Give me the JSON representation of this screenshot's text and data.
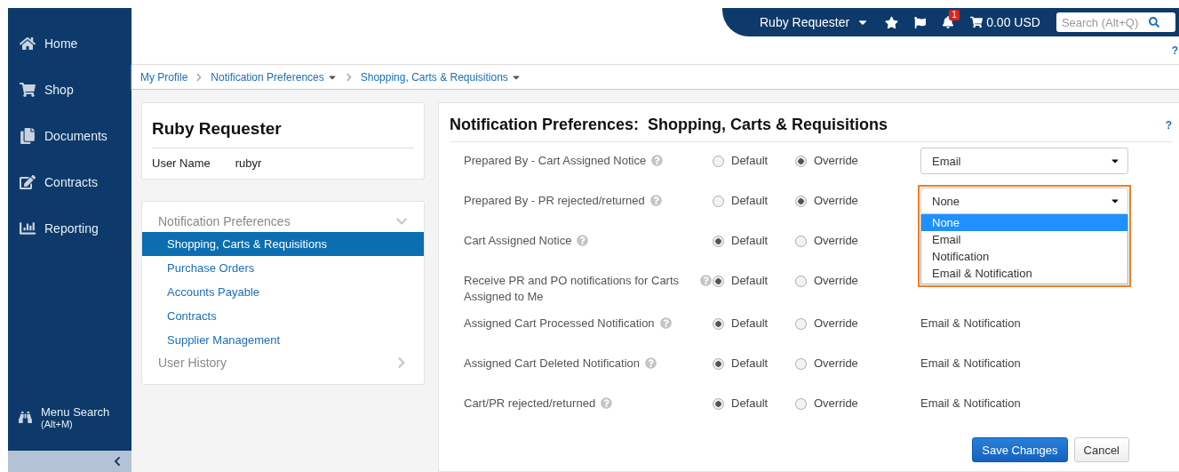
{
  "sidebar": {
    "items": [
      {
        "label": "Home"
      },
      {
        "label": "Shop"
      },
      {
        "label": "Documents"
      },
      {
        "label": "Contracts"
      },
      {
        "label": "Reporting"
      }
    ],
    "menu_search": {
      "label": "Menu Search",
      "shortcut": "(Alt+M)"
    }
  },
  "header": {
    "user": "Ruby Requester",
    "notification_count": "1",
    "cart_total": "0.00 USD",
    "search": {
      "placeholder": "Search (Alt+Q)"
    },
    "help": "?"
  },
  "breadcrumb": [
    {
      "label": "My Profile",
      "has_menu": false
    },
    {
      "label": "Notification Preferences",
      "has_menu": true
    },
    {
      "label": "Shopping, Carts & Requisitions",
      "has_menu": true
    }
  ],
  "profile": {
    "name": "Ruby Requester",
    "user_name_label": "User Name",
    "user_name": "rubyr"
  },
  "nav": [
    {
      "label": "Notification Preferences",
      "expanded": true,
      "children": [
        {
          "label": "Shopping, Carts & Requisitions",
          "selected": true
        },
        {
          "label": "Purchase Orders",
          "selected": false
        },
        {
          "label": "Accounts Payable",
          "selected": false
        },
        {
          "label": "Contracts",
          "selected": false
        },
        {
          "label": "Supplier Management",
          "selected": false
        }
      ]
    },
    {
      "label": "User History",
      "expanded": false
    }
  ],
  "preferences": {
    "title": "Notification Preferences:  Shopping, Carts & Requisitions",
    "help": "?",
    "rows": [
      {
        "label": "Prepared By - Cart Assigned Notice",
        "options": [
          {
            "label": "Default",
            "selected": false
          },
          {
            "label": "Override",
            "selected": true
          }
        ],
        "kind": "select",
        "value": "Email",
        "open": false
      },
      {
        "label": "Prepared By - PR rejected/returned",
        "options": [
          {
            "label": "Default",
            "selected": false
          },
          {
            "label": "Override",
            "selected": true
          }
        ],
        "kind": "select",
        "value": "None",
        "open": true,
        "choices": [
          {
            "label": "None",
            "selected": true
          },
          {
            "label": "Email",
            "selected": false
          },
          {
            "label": "Notification",
            "selected": false
          },
          {
            "label": "Email & Notification",
            "selected": false
          }
        ]
      },
      {
        "label": "Cart Assigned Notice",
        "options": [
          {
            "label": "Default",
            "selected": true
          },
          {
            "label": "Override",
            "selected": false
          }
        ],
        "kind": "text"
      },
      {
        "label": "Receive PR and PO notifications for Carts Assigned to Me",
        "options": [
          {
            "label": "Default",
            "selected": true
          },
          {
            "label": "Override",
            "selected": false
          }
        ],
        "kind": "text"
      },
      {
        "label": "Assigned Cart Processed Notification",
        "options": [
          {
            "label": "Default",
            "selected": true
          },
          {
            "label": "Override",
            "selected": false
          }
        ],
        "kind": "text",
        "value": "Email & Notification"
      },
      {
        "label": "Assigned Cart Deleted Notification",
        "options": [
          {
            "label": "Default",
            "selected": true
          },
          {
            "label": "Override",
            "selected": false
          }
        ],
        "kind": "text",
        "value": "Email & Notification"
      },
      {
        "label": "Cart/PR rejected/returned",
        "options": [
          {
            "label": "Default",
            "selected": true
          },
          {
            "label": "Override",
            "selected": false
          }
        ],
        "kind": "text",
        "value": "Email & Notification"
      }
    ]
  },
  "buttons": [
    {
      "label": "Save Changes",
      "primary": true
    },
    {
      "label": "Cancel",
      "primary": false
    }
  ]
}
